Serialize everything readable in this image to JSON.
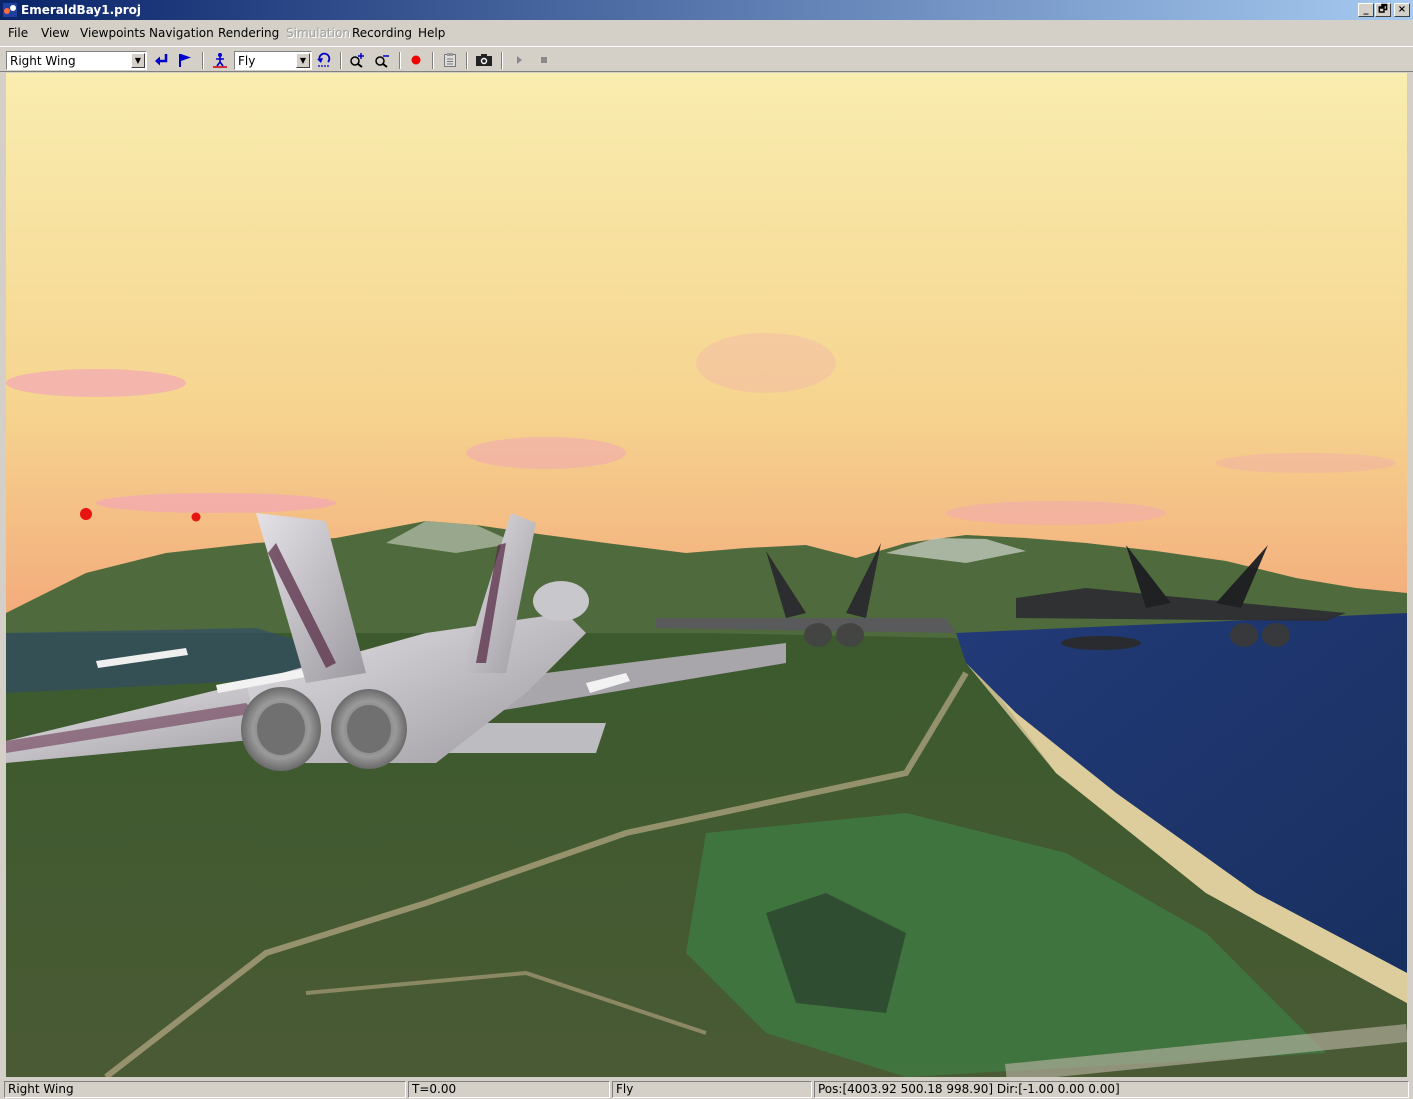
{
  "window": {
    "title": "EmeraldBay1.proj",
    "controls": {
      "minimize": "_",
      "maximize": "🗗",
      "close": "×"
    }
  },
  "menu": [
    {
      "label": "File"
    },
    {
      "label": "View"
    },
    {
      "label": "Viewpoints"
    },
    {
      "label": "Navigation"
    },
    {
      "label": "Rendering"
    },
    {
      "label": "Simulation",
      "disabled": true
    },
    {
      "label": "Recording"
    },
    {
      "label": "Help"
    }
  ],
  "toolbar": {
    "viewpoint_select": "Right Wing",
    "nav_mode_select": "Fly",
    "icons": [
      "return-arrow-icon",
      "flag-icon",
      "walk-person-icon",
      "undo-curve-icon",
      "zoom-in-icon",
      "zoom-out-icon",
      "record-icon",
      "clipboard-icon",
      "camera-icon",
      "play-icon",
      "stop-icon"
    ],
    "colors": {
      "blue": "#0000cc",
      "red": "#ee0000",
      "gray": "#8a8a8a"
    }
  },
  "viewport": {
    "scene": "3d-flight-view",
    "colors": {
      "sky_top": "#f8eaa8",
      "sky_horizon": "#f6b889",
      "lake": "#1c3470",
      "terrain": "#3f5a2a"
    }
  },
  "status": {
    "viewpoint": "Right Wing",
    "time": "T=0.00",
    "mode": "Fly",
    "position": "Pos:[4003.92 500.18 998.90] Dir:[-1.00 0.00 0.00]"
  }
}
